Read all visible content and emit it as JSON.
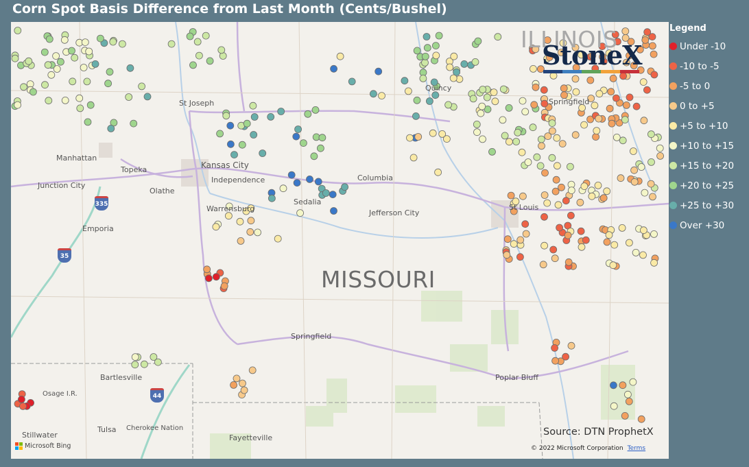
{
  "title": "Corn Spot Basis Difference from Last Month (Cents/Bushel)",
  "legend": {
    "title": "Legend",
    "items": [
      {
        "label": "Under -10",
        "color": "#e0202a"
      },
      {
        "label": "-10 to -5",
        "color": "#ee6346"
      },
      {
        "label": "-5 to 0",
        "color": "#f2a15f"
      },
      {
        "label": "0 to +5",
        "color": "#f7c98a"
      },
      {
        "label": "+5 to +10",
        "color": "#faeaa6"
      },
      {
        "label": "+10 to +15",
        "color": "#f4f6c8"
      },
      {
        "label": "+15 to +20",
        "color": "#cde8a4"
      },
      {
        "label": "+20 to +25",
        "color": "#9fd58d"
      },
      {
        "label": "+25 to +30",
        "color": "#68aeaa"
      },
      {
        "label": "Over +30",
        "color": "#3a78c8"
      }
    ]
  },
  "state_labels": {
    "missouri": "MISSOURI",
    "illinois": "ILLINOIS"
  },
  "places": [
    "St Joseph",
    "Kansas City",
    "Independence",
    "Manhattan",
    "Topeka",
    "Junction City",
    "Olathe",
    "Emporia",
    "Columbia",
    "Sedalia",
    "Warrensburg",
    "Jefferson City",
    "St Louis",
    "Springfield",
    "Quincy",
    "Bartlesville",
    "Osage I.R.",
    "Tulsa",
    "Cherokee Nation",
    "Stillwater",
    "Fayetteville",
    "Poplar Bluff"
  ],
  "shields": [
    "335",
    "35",
    "44"
  ],
  "logo": {
    "text": "StoneX",
    "bar_colors": [
      "#23437a",
      "#3f7fbf",
      "#5fa35a",
      "#f2a23a",
      "#c6303a"
    ]
  },
  "source": "Source: DTN ProphetX",
  "copyright": "© 2022 Microsoft Corporation",
  "terms": "Terms",
  "bing": "Microsoft Bing"
}
